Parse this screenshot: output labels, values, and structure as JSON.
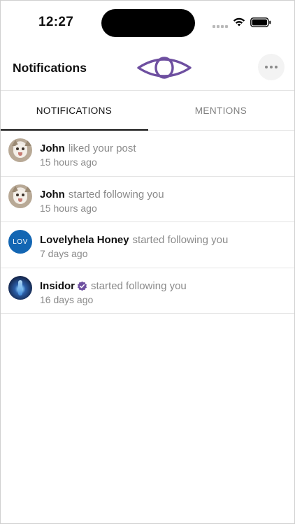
{
  "status_bar": {
    "time": "12:27"
  },
  "header": {
    "title": "Notifications",
    "logo_icon": "eye-logo-icon",
    "more_icon": "more-horizontal-icon"
  },
  "tabs": [
    {
      "label": "NOTIFICATIONS",
      "active": true
    },
    {
      "label": "MENTIONS",
      "active": false
    }
  ],
  "notifications": [
    {
      "name": "John",
      "action": "liked your post",
      "time": "15 hours ago",
      "avatar": "cat-photo"
    },
    {
      "name": "John",
      "action": "started following you",
      "time": "15 hours ago",
      "avatar": "cat-photo"
    },
    {
      "name": "Lovelyhela Honey",
      "action": "started following you",
      "time": "7 days ago",
      "avatar": "LOV"
    },
    {
      "name": "Insidor",
      "action": "started following you",
      "time": "16 days ago",
      "avatar": "insidor-logo",
      "verified": true
    }
  ],
  "colors": {
    "brand": "#6e4fa0",
    "active_tab": "#111111",
    "muted": "#8a8a8a",
    "lov_avatar": "#1366b3"
  }
}
